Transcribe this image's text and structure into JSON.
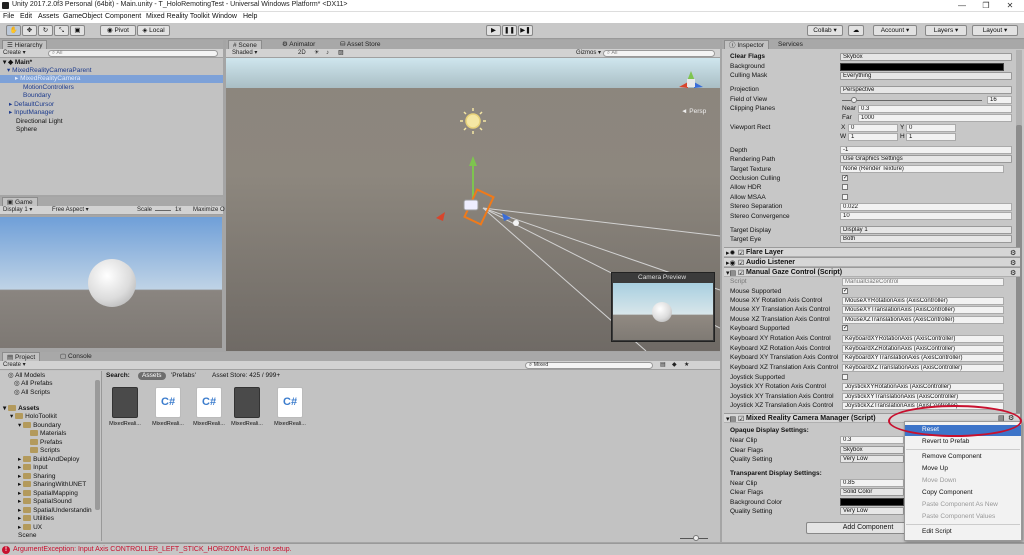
{
  "window": {
    "title": "Unity 2017.2.0f3 Personal (64bit) - Main.unity - T_HoloRemotingTest - Universal Windows Platform* <DX11>"
  },
  "menu": [
    "File",
    "Edit",
    "Assets",
    "GameObject",
    "Component",
    "Mixed Reality Toolkit",
    "Window",
    "Help"
  ],
  "toolbar": {
    "pivot": "Pivot",
    "local": "Local",
    "collab": "Collab",
    "account": "Account",
    "layers": "Layers",
    "layout": "Layout"
  },
  "hierarchy": {
    "tab": "Hierarchy",
    "create": "Create",
    "search": "All",
    "scene_name": "Main*",
    "items": [
      {
        "label": "MixedRealityCameraParent",
        "selected": false
      },
      {
        "label": "MixedRealityCamera",
        "selected": true
      },
      {
        "label": "MotionControllers",
        "selected": false
      },
      {
        "label": "Boundary",
        "selected": false
      },
      {
        "label": "DefaultCursor",
        "selected": false
      },
      {
        "label": "InputManager",
        "selected": false
      },
      {
        "label": "Directional Light",
        "selected": false
      },
      {
        "label": "Sphere",
        "selected": false
      }
    ]
  },
  "game": {
    "tab": "Game",
    "display": "Display 1",
    "aspect": "Free Aspect",
    "scale_label": "Scale",
    "scale_value": "1x",
    "maximize": "Maximize O"
  },
  "scene": {
    "tabs": [
      "Scene",
      "Animator",
      "Asset Store"
    ],
    "shaded": "Shaded",
    "mode_2d": "2D",
    "gizmos": "Gizmos",
    "search": "All",
    "persp": "Persp",
    "camera_preview": "Camera Preview"
  },
  "project": {
    "tabs": [
      "Project",
      "Console"
    ],
    "create": "Create",
    "search_label": "Search:",
    "search_scopes": [
      "Assets",
      "'Prefabs'",
      "Asset Store: 425 / 999+"
    ],
    "search_value": "Mixed",
    "favorites": [
      "All Models",
      "All Prefabs",
      "All Scripts"
    ],
    "tree": [
      {
        "label": "Assets",
        "bold": true
      },
      {
        "label": "HoloToolkit"
      },
      {
        "label": "Boundary"
      },
      {
        "label": "Materials"
      },
      {
        "label": "Prefabs"
      },
      {
        "label": "Scripts"
      },
      {
        "label": "BuildAndDeploy"
      },
      {
        "label": "Input"
      },
      {
        "label": "Sharing"
      },
      {
        "label": "SharingWithUNET"
      },
      {
        "label": "SpatialMapping"
      },
      {
        "label": "SpatialSound"
      },
      {
        "label": "SpatialUnderstandin"
      },
      {
        "label": "Utilities"
      },
      {
        "label": "UX"
      },
      {
        "label": "Scene"
      }
    ],
    "assets": [
      {
        "label": "MixedReali...",
        "kind": "prefab"
      },
      {
        "label": "MixedReali...",
        "kind": "cs"
      },
      {
        "label": "MixedReali...",
        "kind": "cs"
      },
      {
        "label": "MixedReali...",
        "kind": "prefab"
      },
      {
        "label": "MixedReali...",
        "kind": "cs"
      }
    ]
  },
  "inspector": {
    "tabs": [
      "Inspector",
      "Services"
    ],
    "camera": [
      {
        "label": "Clear Flags",
        "value": "Skybox"
      },
      {
        "label": "Background",
        "value": ""
      },
      {
        "label": "Culling Mask",
        "value": "Everything"
      },
      {
        "label": "Projection",
        "value": "Perspective"
      },
      {
        "label": "Field of View",
        "value": "16"
      },
      {
        "label": "Clipping Planes",
        "value": ""
      },
      {
        "label": "Near",
        "value": "0.3"
      },
      {
        "label": "Far",
        "value": "1000"
      },
      {
        "label": "Viewport Rect",
        "value": ""
      },
      {
        "label": "Depth",
        "value": "-1"
      },
      {
        "label": "Rendering Path",
        "value": "Use Graphics Settings"
      },
      {
        "label": "Target Texture",
        "value": "None (Render Texture)"
      },
      {
        "label": "Occlusion Culling",
        "value": ""
      },
      {
        "label": "Allow HDR",
        "value": ""
      },
      {
        "label": "Allow MSAA",
        "value": ""
      },
      {
        "label": "Stereo Separation",
        "value": "0.022"
      },
      {
        "label": "Stereo Convergence",
        "value": "10"
      },
      {
        "label": "Target Display",
        "value": "Display 1"
      },
      {
        "label": "Target Eye",
        "value": "Both"
      }
    ],
    "viewport": {
      "x_label": "X",
      "x": "0",
      "y_label": "Y",
      "y": "0",
      "w_label": "W",
      "w": "1",
      "h_label": "H",
      "h": "1"
    },
    "flare_layer": "Flare Layer",
    "audio_listener": "Audio Listener",
    "gaze": {
      "title": "Manual Gaze Control (Script)",
      "rows": [
        {
          "label": "Script",
          "value": "ManualGazeControl"
        },
        {
          "label": "Mouse Supported",
          "value": ""
        },
        {
          "label": "Mouse XY Rotation Axis Control",
          "value": "MouseXYRotationAxis (AxisController)"
        },
        {
          "label": "Mouse XY Translation Axis Control",
          "value": "MouseXYTranslationAxis (AxisController)"
        },
        {
          "label": "Mouse XZ Translation Axis Control",
          "value": "MouseXZTranslationAxis (AxisController)"
        },
        {
          "label": "Keyboard Supported",
          "value": ""
        },
        {
          "label": "Keyboard XY Rotation Axis Control",
          "value": "KeyboardXYRotationAxis (AxisController)"
        },
        {
          "label": "Keyboard XZ Rotation Axis Control",
          "value": "KeyboardXZRotationAxis (AxisController)"
        },
        {
          "label": "Keyboard XY Translation Axis Control",
          "value": "KeyboardXYTranslationAxis (AxisController)"
        },
        {
          "label": "Keyboard XZ Translation Axis Control",
          "value": "KeyboardXZTranslationAxis (AxisController)"
        },
        {
          "label": "Joystick Supported",
          "value": ""
        },
        {
          "label": "Joystick XY Rotation Axis Control",
          "value": "JoystickXYRotationAxis (AxisController)"
        },
        {
          "label": "Joystick XY Translation Axis Control",
          "value": "JoystickXYTranslationAxis (AxisController)"
        },
        {
          "label": "Joystick XZ Translation Axis Control",
          "value": "JoystickXZTranslationAxis (AxisController)"
        }
      ]
    },
    "mrcm": {
      "title": "Mixed Reality Camera Manager (Script)",
      "opaque": "Opaque Display Settings:",
      "transparent": "Transparent Display Settings:",
      "rows": [
        {
          "label": "Near Clip",
          "value": "0.3"
        },
        {
          "label": "Clear Flags",
          "value": "Skybox"
        },
        {
          "label": "Quality Setting",
          "value": "Very Low"
        },
        {
          "label": "Near Clip",
          "value": "0.85"
        },
        {
          "label": "Clear Flags",
          "value": "Solid Color"
        },
        {
          "label": "Background Color",
          "value": ""
        },
        {
          "label": "Quality Setting",
          "value": "Very Low"
        }
      ]
    },
    "add_component": "Add Component"
  },
  "context_menu": [
    {
      "label": "Reset",
      "disabled": false,
      "highlighted": true
    },
    {
      "label": "Revert to Prefab",
      "disabled": false
    },
    {
      "label": "Remove Component",
      "disabled": false
    },
    {
      "label": "Move Up",
      "disabled": false
    },
    {
      "label": "Move Down",
      "disabled": true
    },
    {
      "label": "Copy Component",
      "disabled": false
    },
    {
      "label": "Paste Component As New",
      "disabled": true
    },
    {
      "label": "Paste Component Values",
      "disabled": true
    },
    {
      "label": "Edit Script",
      "disabled": false
    }
  ],
  "status": {
    "message": "ArgumentException: Input Axis CONTROLLER_LEFT_STICK_HORIZONTAL is not setup."
  },
  "colors": {
    "accent": "#7da1d8",
    "error": "#c8102e",
    "highlight": "#3d74c9"
  }
}
